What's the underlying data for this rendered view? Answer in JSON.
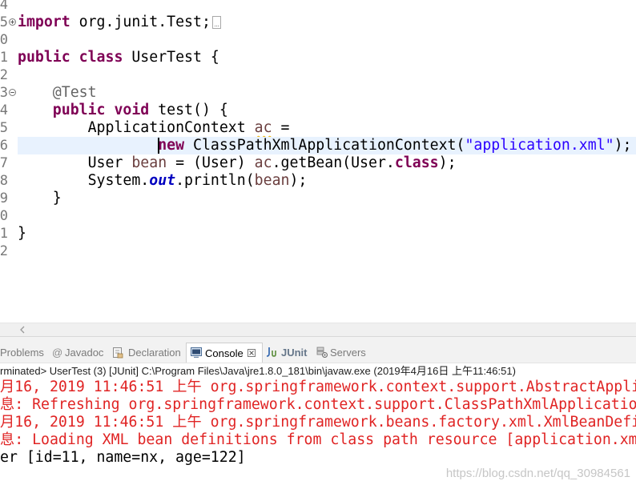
{
  "editor": {
    "line_numbers": [
      "4",
      "5",
      "0",
      "1",
      "2",
      "3",
      "4",
      "5",
      "6",
      "7",
      "8",
      "9",
      "0",
      "1",
      "2"
    ],
    "lines": [
      [],
      [
        "import",
        " org.junit.Test;"
      ],
      [],
      [
        "public class",
        " UserTest {"
      ],
      [],
      [
        "@Test"
      ],
      [
        "public void",
        " test() {"
      ],
      [
        "ApplicationContext ",
        "ac",
        " ="
      ],
      [
        "new",
        " ClassPathXmlApplicationContext(",
        "\"application.xml\"",
        ");"
      ],
      [
        "User ",
        "bean",
        " = (User) ",
        "ac",
        ".getBean(User.",
        "class",
        ");"
      ],
      [
        "System.",
        "out",
        ".println(",
        "bean",
        ");"
      ],
      [
        "}"
      ],
      [],
      [
        "}"
      ],
      []
    ],
    "current_line_index": 8
  },
  "console": {
    "tabs": [
      "Problems",
      "Javadoc",
      "Declaration",
      "Console",
      "JUnit",
      "Servers"
    ],
    "active_tab_index": 3,
    "process_label": "rminated> UserTest (3) [JUnit] C:\\Program Files\\Java\\jre1.8.0_181\\bin\\javaw.exe (2019年4月16日 上午11:46:51)",
    "output": [
      "月16, 2019 11:46:51 上午 org.springframework.context.support.AbstractApplic",
      "息: Refreshing org.springframework.context.support.ClassPathXmlApplicatio",
      "月16, 2019 11:46:51 上午 org.springframework.beans.factory.xml.XmlBeanDefin",
      "息: Loading XML bean definitions from class path resource [application.xml",
      "er [id=11, name=nx, age=122]"
    ]
  },
  "watermark": "https://blog.csdn.net/qq_30984561",
  "icons": {
    "import_fold": "fold-expand-icon",
    "method_fold": "fold-collapse-icon",
    "folded_imports": "folded-code-marker",
    "scroll_left": "chevron-left-icon",
    "javadoc": "javadoc-at-icon",
    "declaration": "declaration-icon",
    "console": "console-icon",
    "console_close": "close-icon",
    "junit": "junit-icon",
    "servers": "servers-icon"
  },
  "colors": {
    "keyword": "#7F0055",
    "annotation": "#646464",
    "string": "#2A00FF",
    "static_field": "#0000C0",
    "local_variable": "#6A3E3E",
    "line_number": "#787878",
    "current_line": "#E8F2FE",
    "warning_squiggle": "#F0B400",
    "console_error": "#E02424",
    "console_output": "#000000"
  }
}
